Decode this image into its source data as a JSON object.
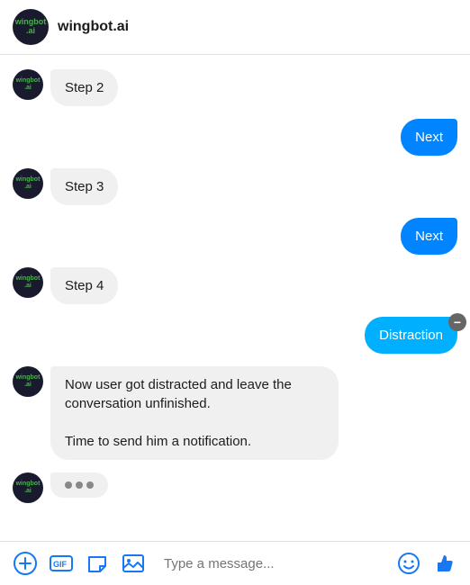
{
  "header": {
    "logo_text": "wingbot\n.ai",
    "title": "wingbot.ai"
  },
  "messages": [
    {
      "id": "step2",
      "type": "bot",
      "text": "Step 2"
    },
    {
      "id": "next1",
      "type": "user",
      "text": "Next"
    },
    {
      "id": "step3",
      "type": "bot",
      "text": "Step 3"
    },
    {
      "id": "next2",
      "type": "user",
      "text": "Next"
    },
    {
      "id": "step4",
      "type": "bot",
      "text": "Step 4"
    },
    {
      "id": "distraction",
      "type": "user",
      "text": "Distraction",
      "special": "distraction"
    },
    {
      "id": "bot-multiline",
      "type": "bot-multiline",
      "line1": "Now user got distracted and leave the conversation unfinished.",
      "line2": "Time to send him a notification."
    },
    {
      "id": "typing",
      "type": "typing"
    }
  ],
  "toolbar": {
    "input_placeholder": "Type a message...",
    "add_label": "+",
    "gif_label": "GIF"
  },
  "colors": {
    "user_bubble": "#0084ff",
    "distraction_bubble": "#1aade0",
    "bot_bubble": "#f0f0f0",
    "header_avatar_bg": "#1a1a2e",
    "logo_green": "#4CAF50"
  }
}
